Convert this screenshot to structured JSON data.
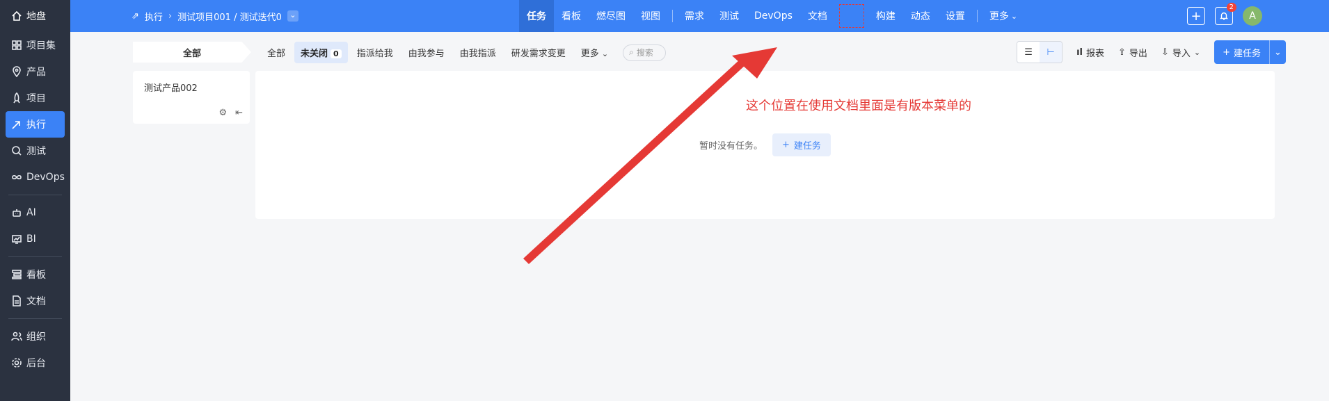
{
  "sidebar": {
    "items": [
      {
        "label": "地盘",
        "icon": "home-icon"
      },
      {
        "label": "项目集",
        "icon": "grid-icon"
      },
      {
        "label": "产品",
        "icon": "location-icon"
      },
      {
        "label": "项目",
        "icon": "rocket-icon"
      },
      {
        "label": "执行",
        "icon": "execute-icon",
        "active": true
      },
      {
        "label": "测试",
        "icon": "test-icon"
      },
      {
        "label": "DevOps",
        "icon": "infinity-icon"
      },
      {
        "label": "AI",
        "icon": "robot-icon"
      },
      {
        "label": "BI",
        "icon": "chart-icon"
      },
      {
        "label": "看板",
        "icon": "kanban-icon"
      },
      {
        "label": "文档",
        "icon": "doc-icon"
      },
      {
        "label": "组织",
        "icon": "people-icon"
      },
      {
        "label": "后台",
        "icon": "gear-icon"
      }
    ]
  },
  "topbar": {
    "crumb_module": "执行",
    "crumb_path": "测试项目001 / 测试迭代0",
    "nav": [
      "任务",
      "看板",
      "燃尽图",
      "视图",
      "需求",
      "测试",
      "DevOps",
      "文档",
      "构建",
      "动态",
      "设置",
      "更多"
    ],
    "notification_count": "2",
    "avatar_letter": "A",
    "accent": "#3b82f6"
  },
  "toolbar": {
    "tab_all": "全部",
    "filters": [
      "全部",
      "未关闭",
      "指派给我",
      "由我参与",
      "由我指派",
      "研发需求变更",
      "更多"
    ],
    "unclosed_count": "0",
    "search_placeholder": "搜索",
    "report": "报表",
    "export": "导出",
    "import": "导入",
    "new_task": "建任务"
  },
  "product_panel": {
    "name": "测试产品002"
  },
  "main": {
    "empty_text": "暂时没有任务。",
    "empty_button": "建任务"
  },
  "annotation": {
    "text": "这个位置在使用文档里面是有版本菜单的",
    "color": "#e53935"
  }
}
